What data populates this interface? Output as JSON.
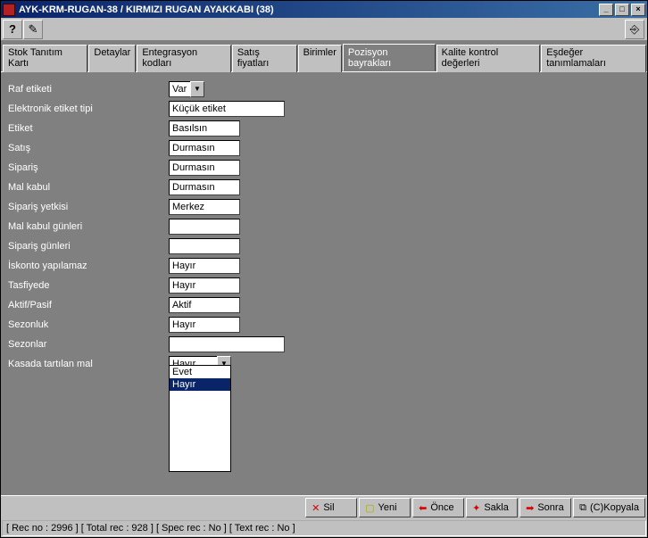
{
  "window": {
    "title": "AYK-KRM-RUGAN-38 / KIRMIZI RUGAN AYAKKABI (38)"
  },
  "tabs": [
    "Stok Tanıtım Kartı",
    "Detaylar",
    "Entegrasyon kodları",
    "Satış fiyatları",
    "Birimler",
    "Pozisyon bayrakları",
    "Kalite kontrol değerleri",
    "Eşdeğer tanımlamaları"
  ],
  "form": {
    "raf_etiketi": {
      "label": "Raf etiketi",
      "value": "Var"
    },
    "elektronik_etiket": {
      "label": "Elektronik etiket tipi",
      "value": "Küçük etiket"
    },
    "etiket": {
      "label": "Etiket",
      "value": "Basılsın"
    },
    "satis": {
      "label": "Satış",
      "value": "Durmasın"
    },
    "siparis": {
      "label": "Sipariş",
      "value": "Durmasın"
    },
    "mal_kabul": {
      "label": "Mal kabul",
      "value": "Durmasın"
    },
    "siparis_yetkisi": {
      "label": "Sipariş yetkisi",
      "value": "Merkez"
    },
    "mal_kabul_gunleri": {
      "label": "Mal kabul günleri",
      "value": ""
    },
    "siparis_gunleri": {
      "label": "Sipariş günleri",
      "value": ""
    },
    "iskonto": {
      "label": "İskonto yapılamaz",
      "value": "Hayır"
    },
    "tasfiyede": {
      "label": "Tasfiyede",
      "value": "Hayır"
    },
    "aktif_pasif": {
      "label": "Aktif/Pasif",
      "value": "Aktif"
    },
    "sezonluk": {
      "label": "Sezonluk",
      "value": "Hayır"
    },
    "sezonlar": {
      "label": "Sezonlar",
      "value": ""
    },
    "kasada": {
      "label": "Kasada tartılan mal",
      "value": "Hayır",
      "options": [
        "Evet",
        "Hayır"
      ]
    }
  },
  "footer": {
    "sil": "Sil",
    "yeni": "Yeni",
    "once": "Önce",
    "sakla": "Sakla",
    "sonra": "Sonra",
    "kopyala": "(C)Kopyala"
  },
  "status": "[ Rec no :   2996 ] [ Total rec :    928 ] [ Spec rec : No ]  [ Text rec : No ]"
}
